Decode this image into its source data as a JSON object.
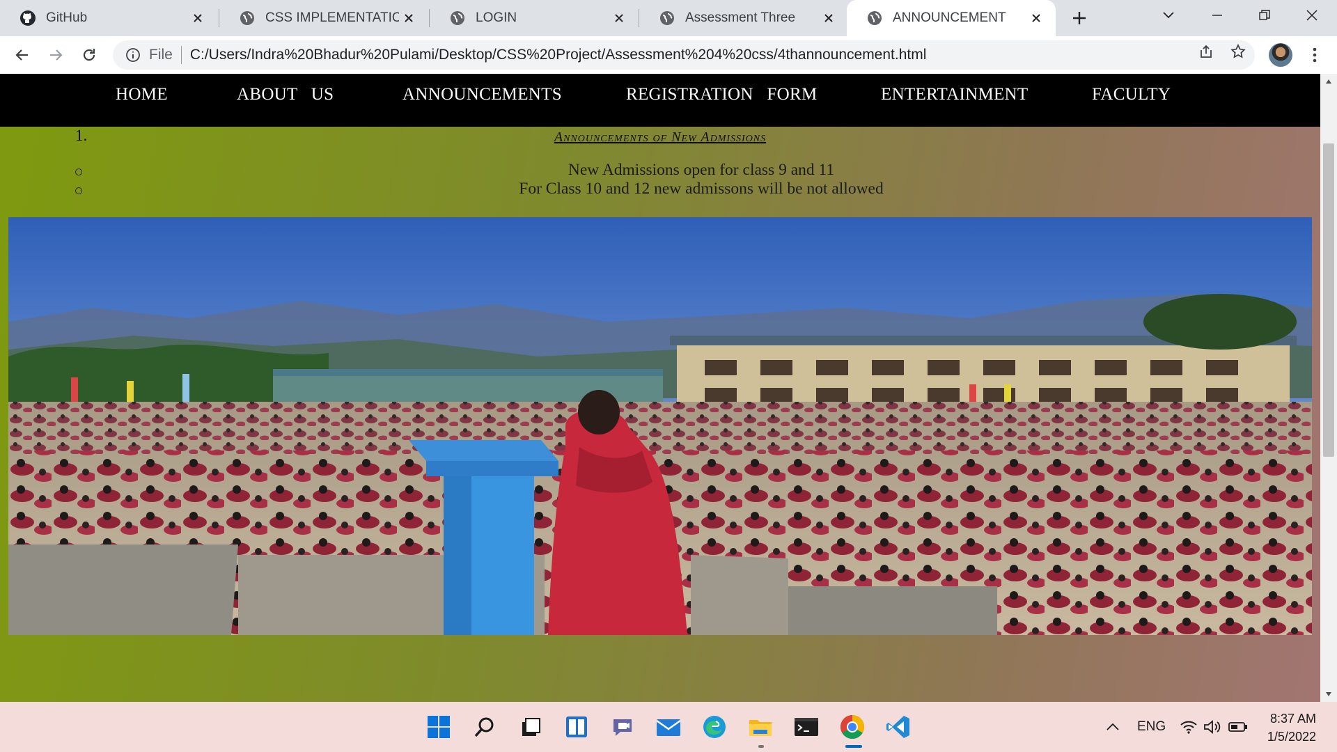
{
  "browser": {
    "tabs": [
      {
        "title": "GitHub",
        "icon": "github-icon"
      },
      {
        "title": "CSS IMPLEMENTATION",
        "icon": "globe-icon"
      },
      {
        "title": "LOGIN",
        "icon": "globe-icon"
      },
      {
        "title": "Assessment Three",
        "icon": "globe-icon"
      },
      {
        "title": "ANNOUNCEMENT",
        "icon": "globe-icon",
        "active": true
      }
    ],
    "address_prefix": "File",
    "url": "C:/Users/Indra%20Bhadur%20Pulami/Desktop/CSS%20Project/Assessment%204%20css/4thannouncement.html"
  },
  "site": {
    "nav": [
      "HOME",
      "ABOUT   US",
      "ANNOUNCEMENTS",
      "REGISTRATION   FORM",
      "ENTERTAINMENT",
      "FACULTY"
    ],
    "list_number": "1.",
    "announcement_title": "Announcements of New Admissions",
    "announcements": [
      "New Admissions open for class 9 and 11",
      "For Class 10 and 12 new admissons will be not allowed"
    ],
    "background_colors": [
      "#7f9a0f",
      "#a27572"
    ]
  },
  "taskbar": {
    "apps": [
      "windows-start-icon",
      "search-icon",
      "task-view-icon",
      "widgets-icon",
      "teams-chat-icon",
      "mail-icon",
      "edge-icon",
      "file-explorer-icon",
      "terminal-icon",
      "chrome-icon",
      "vscode-icon"
    ],
    "language": "ENG",
    "time": "8:37 AM",
    "date": "1/5/2022"
  }
}
